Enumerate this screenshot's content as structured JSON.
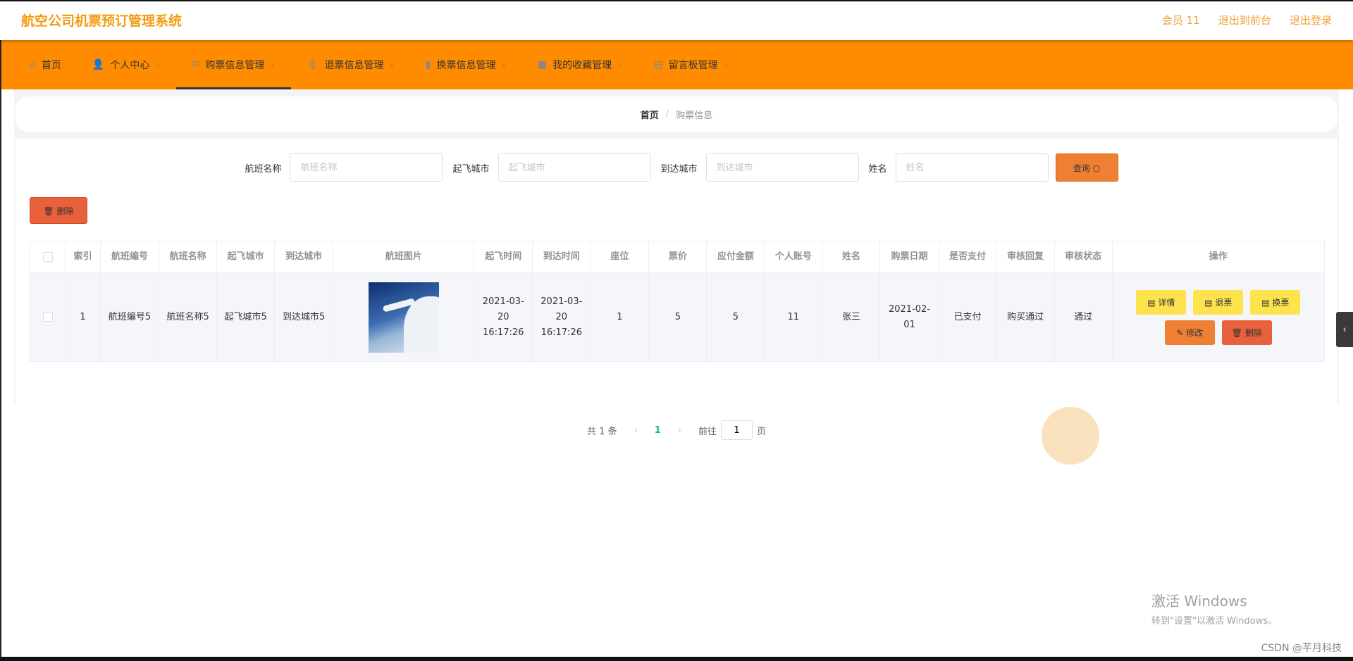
{
  "header": {
    "title": "航空公司机票预订管理系统",
    "user": "会员 11",
    "links": [
      "退出到前台",
      "退出登录"
    ]
  },
  "nav": [
    {
      "label": "首页",
      "icon": "home-icon"
    },
    {
      "label": "个人中心",
      "icon": "user-icon"
    },
    {
      "label": "购票信息管理",
      "icon": "mail-icon",
      "active": true
    },
    {
      "label": "退票信息管理",
      "icon": "microphone-icon"
    },
    {
      "label": "换票信息管理",
      "icon": "chart-icon"
    },
    {
      "label": "我的收藏管理",
      "icon": "video-icon"
    },
    {
      "label": "留言板管理",
      "icon": "notebook-icon"
    }
  ],
  "breadcrumb": {
    "home": "首页",
    "current": "购票信息"
  },
  "search": {
    "fields": [
      {
        "label": "航班名称",
        "placeholder": "航班名称"
      },
      {
        "label": "起飞城市",
        "placeholder": "起飞城市"
      },
      {
        "label": "到达城市",
        "placeholder": "到达城市"
      },
      {
        "label": "姓名",
        "placeholder": "姓名"
      }
    ],
    "query_label": "查询 ○"
  },
  "delete_label": "🗑 删除",
  "table": {
    "headers": [
      "索引",
      "航班编号",
      "航班名称",
      "起飞城市",
      "到达城市",
      "航班图片",
      "起飞时间",
      "到达时间",
      "座位",
      "票价",
      "应付金额",
      "个人账号",
      "姓名",
      "购票日期",
      "是否支付",
      "审核回复",
      "审核状态",
      "操作"
    ],
    "rows": [
      {
        "cells": [
          "1",
          "航班编号5",
          "航班名称5",
          "起飞城市5",
          "到达城市5",
          "",
          "2021-03-20 16:17:26",
          "2021-03-20 16:17:26",
          "1",
          "5",
          "5",
          "11",
          "张三",
          "2021-02-01",
          "已支付",
          "购买通过",
          "通过"
        ]
      }
    ],
    "actions": [
      "▤ 详情",
      "▤ 退票",
      "▤ 换票",
      "✎ 修改",
      "🗑 删除"
    ]
  },
  "pagination": {
    "total": "共 1 条",
    "page": "1",
    "goto": "前往",
    "goto_value": "1",
    "suffix": "页"
  },
  "watermark": {
    "line1": "激活 Windows",
    "line2": "转到\"设置\"以激活 Windows。"
  },
  "credit": "CSDN @芊月科技",
  "colors": {
    "accent": "#ff8c00",
    "title": "#f39c12",
    "success": "#19be6b"
  }
}
